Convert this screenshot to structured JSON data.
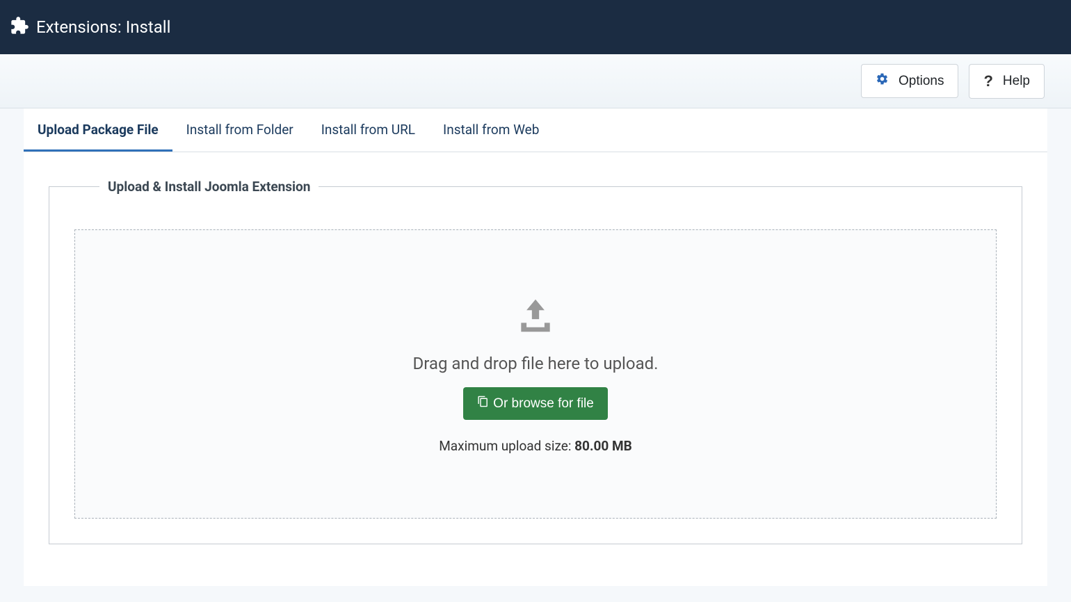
{
  "header": {
    "title": "Extensions: Install"
  },
  "toolbar": {
    "options_label": "Options",
    "help_label": "Help"
  },
  "tabs": [
    {
      "label": "Upload Package File",
      "active": true
    },
    {
      "label": "Install from Folder",
      "active": false
    },
    {
      "label": "Install from URL",
      "active": false
    },
    {
      "label": "Install from Web",
      "active": false
    }
  ],
  "panel": {
    "legend": "Upload & Install Joomla Extension",
    "drop_text": "Drag and drop file here to upload.",
    "browse_button": "Or browse for file",
    "max_size_label": "Maximum upload size: ",
    "max_size_value": "80.00 MB"
  }
}
